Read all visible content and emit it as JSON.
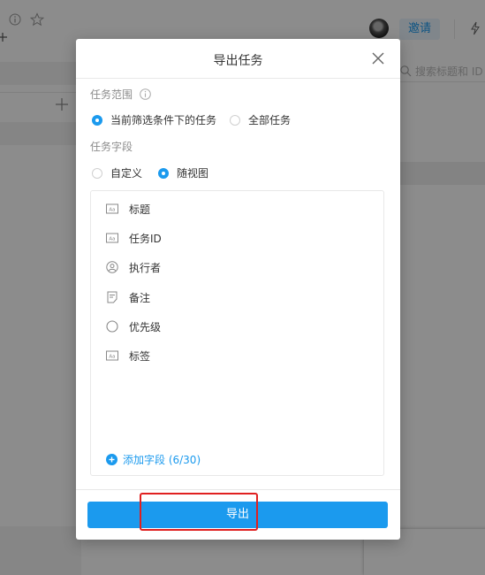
{
  "background": {
    "invite_label": "邀请",
    "search_placeholder": "搜索标题和 ID",
    "icons": [
      "info-icon",
      "star-icon",
      "plus-icon",
      "avatar",
      "bolt-icon",
      "search-icon"
    ]
  },
  "modal": {
    "title": "导出任务",
    "close_icon": "close-icon",
    "scope": {
      "label": "任务范围",
      "options": [
        {
          "label": "当前筛选条件下的任务",
          "selected": true
        },
        {
          "label": "全部任务",
          "selected": false
        }
      ]
    },
    "fields": {
      "label": "任务字段",
      "options": [
        {
          "label": "自定义",
          "selected": false
        },
        {
          "label": "随视图",
          "selected": true
        }
      ],
      "items": [
        {
          "label": "标题",
          "icon": "text-field-icon"
        },
        {
          "label": "任务ID",
          "icon": "text-field-icon"
        },
        {
          "label": "执行者",
          "icon": "user-icon"
        },
        {
          "label": "备注",
          "icon": "note-icon"
        },
        {
          "label": "优先级",
          "icon": "circle-icon"
        },
        {
          "label": "标签",
          "icon": "text-field-icon"
        }
      ],
      "add_field_label": "添加字段 (6/30)"
    },
    "export_label": "导出"
  },
  "colors": {
    "accent": "#1b9aee",
    "highlight": "#e02020"
  }
}
